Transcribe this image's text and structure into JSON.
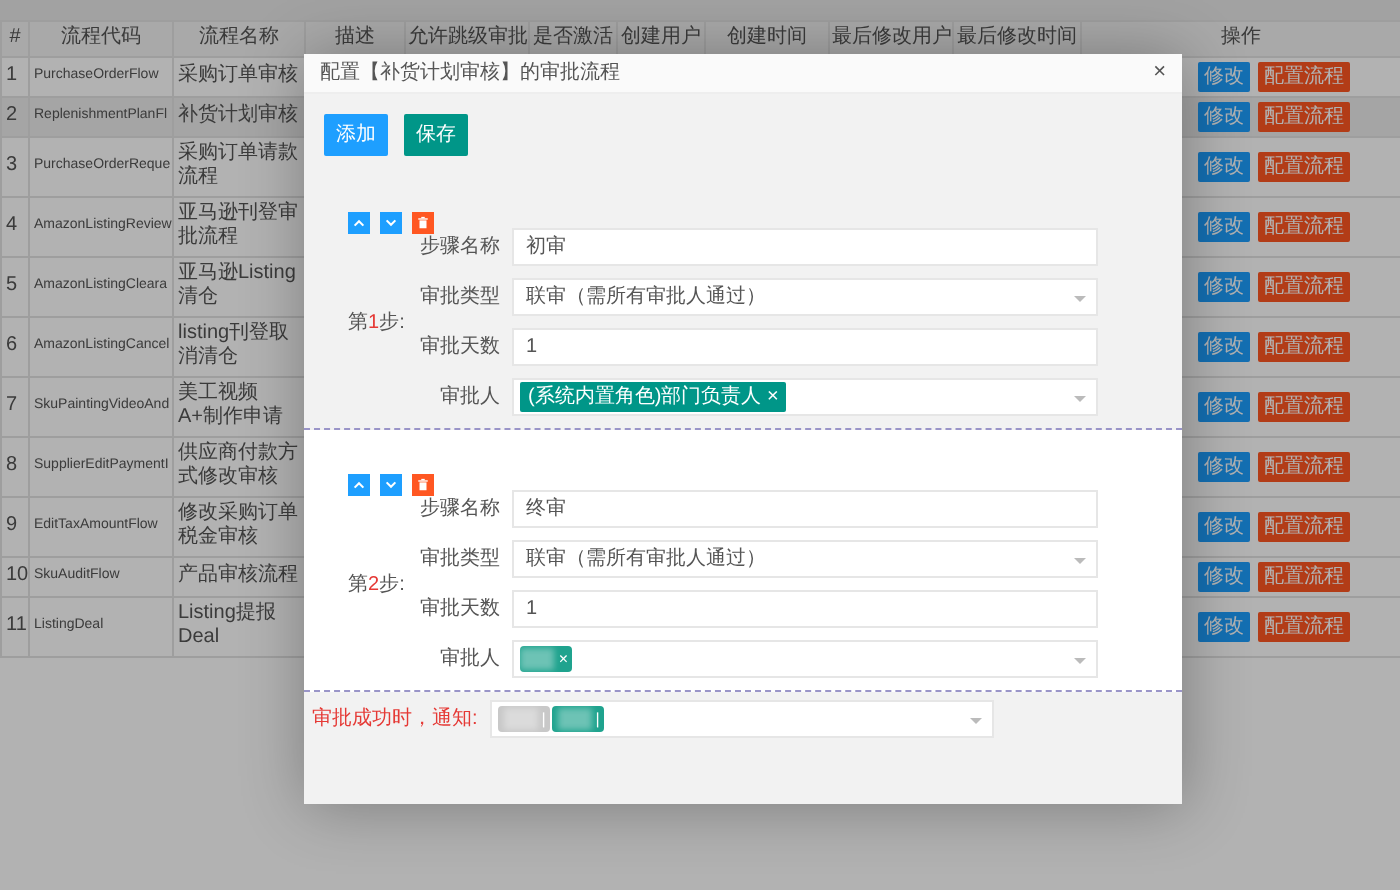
{
  "table": {
    "columns": [
      "#",
      "流程代码",
      "流程名称",
      "描述",
      "允许跳级审批",
      "是否激活",
      "创建用户",
      "创建时间",
      "最后修改用户",
      "最后修改时间",
      "操作"
    ],
    "rows": [
      {
        "index": "1",
        "code": "PurchaseOrderFlow",
        "name": "采购订单审核",
        "selected": false,
        "actions": [
          "修改",
          "配置流程"
        ]
      },
      {
        "index": "2",
        "code": "ReplenishmentPlanFl",
        "name": "补货计划审核",
        "selected": true,
        "actions": [
          "修改",
          "配置流程"
        ]
      },
      {
        "index": "3",
        "code": "PurchaseOrderReque",
        "name": "采购订单请款流程",
        "selected": false,
        "actions": [
          "修改",
          "配置流程"
        ]
      },
      {
        "index": "4",
        "code": "AmazonListingReview",
        "name": "亚马逊刊登审批流程",
        "selected": false,
        "actions": [
          "修改",
          "配置流程"
        ]
      },
      {
        "index": "5",
        "code": "AmazonListingCleara",
        "name": "亚马逊Listing清仓",
        "selected": false,
        "actions": [
          "修改",
          "配置流程"
        ]
      },
      {
        "index": "6",
        "code": "AmazonListingCancel",
        "name": "listing刊登取消清仓",
        "selected": false,
        "actions": [
          "修改",
          "配置流程"
        ]
      },
      {
        "index": "7",
        "code": "SkuPaintingVideoAnd",
        "name": "美工视频A+制作申请",
        "selected": false,
        "actions": [
          "修改",
          "配置流程"
        ]
      },
      {
        "index": "8",
        "code": "SupplierEditPaymentI",
        "name": "供应商付款方式修改审核",
        "selected": false,
        "actions": [
          "修改",
          "配置流程"
        ]
      },
      {
        "index": "9",
        "code": "EditTaxAmountFlow",
        "name": "修改采购订单税金审核",
        "selected": false,
        "actions": [
          "修改",
          "配置流程"
        ]
      },
      {
        "index": "10",
        "code": "SkuAuditFlow",
        "name": "产品审核流程",
        "selected": false,
        "actions": [
          "修改",
          "配置流程"
        ]
      },
      {
        "index": "11",
        "code": "ListingDeal",
        "name": "Listing提报Deal",
        "selected": false,
        "actions": [
          "修改",
          "配置流程"
        ]
      }
    ]
  },
  "modal": {
    "title": "配置【补货计划审核】的审批流程",
    "close": "×",
    "buttons": [
      "添加",
      "保存"
    ],
    "steps": [
      {
        "prefix": "第",
        "number": "1",
        "suffix": "步:",
        "fields": [
          {
            "kind": "text",
            "label": "步骤名称",
            "value": "初审"
          },
          {
            "kind": "select",
            "label": "审批类型",
            "value": "联审（需所有审批人通过）"
          },
          {
            "kind": "text",
            "label": "审批天数",
            "value": "1"
          },
          {
            "kind": "tags",
            "label": "审批人",
            "tags": [
              {
                "kind": "tag",
                "label": "(系统内置角色)部门负责人",
                "close": "×",
                "color": "#009688"
              }
            ]
          }
        ]
      },
      {
        "prefix": "第",
        "number": "2",
        "suffix": "步:",
        "fields": [
          {
            "kind": "text",
            "label": "步骤名称",
            "value": "终审"
          },
          {
            "kind": "select",
            "label": "审批类型",
            "value": "联审（需所有审批人通过）"
          },
          {
            "kind": "text",
            "label": "审批天数",
            "value": "1"
          },
          {
            "kind": "tags",
            "label": "审批人",
            "tags": [
              {
                "kind": "redacted",
                "close": "×",
                "color": "#1fa38e"
              }
            ]
          }
        ]
      }
    ],
    "notify": {
      "label": "审批成功时，通知:",
      "tags": [
        {
          "kind": "redacted",
          "close": "|",
          "color": "#c8c8c8"
        },
        {
          "kind": "redacted",
          "close": "|",
          "color": "#1fa38e"
        }
      ]
    }
  }
}
